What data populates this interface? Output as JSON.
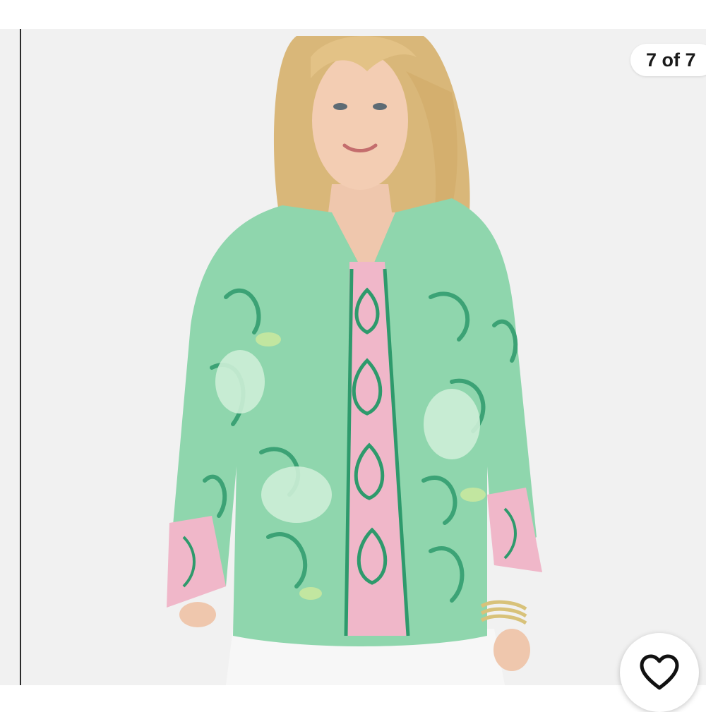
{
  "gallery": {
    "counter_text": "7 of 7",
    "current_index": 7,
    "total_images": 7
  },
  "favorite": {
    "icon": "heart-outline-icon"
  },
  "colors": {
    "background": "#f1f1f1",
    "blouse_green": "#8fd6ad",
    "blouse_dark_green": "#2e9a6c",
    "placket_pink": "#f0b7c9",
    "pants_white": "#fafafa"
  }
}
